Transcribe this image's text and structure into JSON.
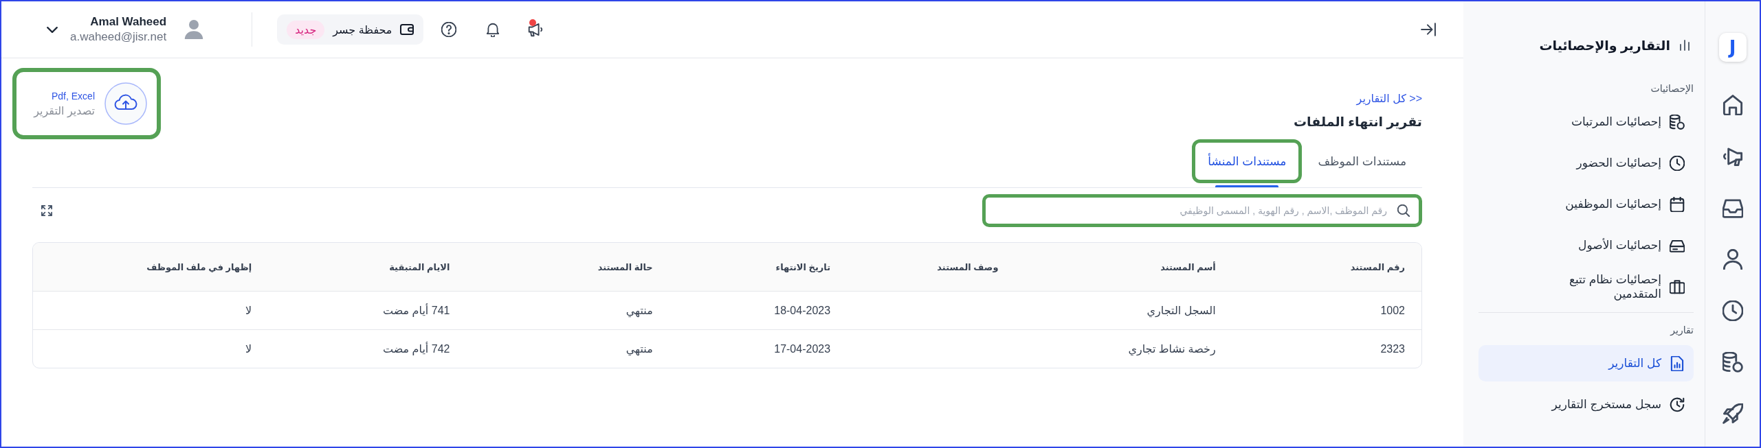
{
  "icon_rail": {
    "logo": "J"
  },
  "sidebar": {
    "title": "التقارير والإحصائيات",
    "sections": [
      {
        "label": "الإحصائيات",
        "items": [
          {
            "label": "إحصائيات المرتبات",
            "selected": false
          },
          {
            "label": "إحصائيات الحضور",
            "selected": false
          },
          {
            "label": "إحصائيات الموظفين",
            "selected": false
          },
          {
            "label": "إحصائيات الأصول",
            "selected": false
          },
          {
            "label": "إحصائيات نظام تتبع المتقدمين",
            "selected": false
          }
        ]
      },
      {
        "label": "تقارير",
        "items": [
          {
            "label": "كل التقارير",
            "selected": true
          },
          {
            "label": "سجل مستخرج التقارير",
            "selected": false
          }
        ]
      }
    ]
  },
  "topbar": {
    "user": {
      "name": "Amal Waheed",
      "email": "a.waheed@jisr.net"
    },
    "wallet": {
      "label": "محفظة جسر",
      "badge": "جديد"
    },
    "announcements": {
      "unread": true
    }
  },
  "page": {
    "breadcrumb": "<< كل التقارير",
    "title": "تقرير انتهاء الملفات",
    "export": {
      "formats": "Pdf, Excel",
      "label": "تصدير التقرير",
      "highlighted": true
    },
    "tabs": [
      {
        "label": "مستندات الموظف",
        "selected": false,
        "highlighted": false
      },
      {
        "label": "مستندات المنشأ",
        "selected": true,
        "highlighted": true
      }
    ],
    "search": {
      "placeholder": "رقم الموظف ,الاسم , رقم الهوية , المسمى الوظيفي",
      "highlighted": true
    },
    "table": {
      "columns": [
        "رقم المستند",
        "أسم المستند",
        "وصف المستند",
        "تاريخ الانتهاء",
        "حالة المستند",
        "الايام المتبقية",
        "إظهار في ملف الموظف"
      ],
      "rows": [
        {
          "number": "1002",
          "name": "السجل التجاري",
          "expiry_date": "18-04-2023",
          "status": "منتهي",
          "remaining": "741 أيام مضت",
          "show_in_profile": "لا"
        },
        {
          "number": "2323",
          "name": "رخصة نشاط تجاري",
          "expiry_date": "17-04-2023",
          "status": "منتهي",
          "remaining": "742 أيام مضت",
          "show_in_profile": "لا"
        }
      ]
    }
  }
}
